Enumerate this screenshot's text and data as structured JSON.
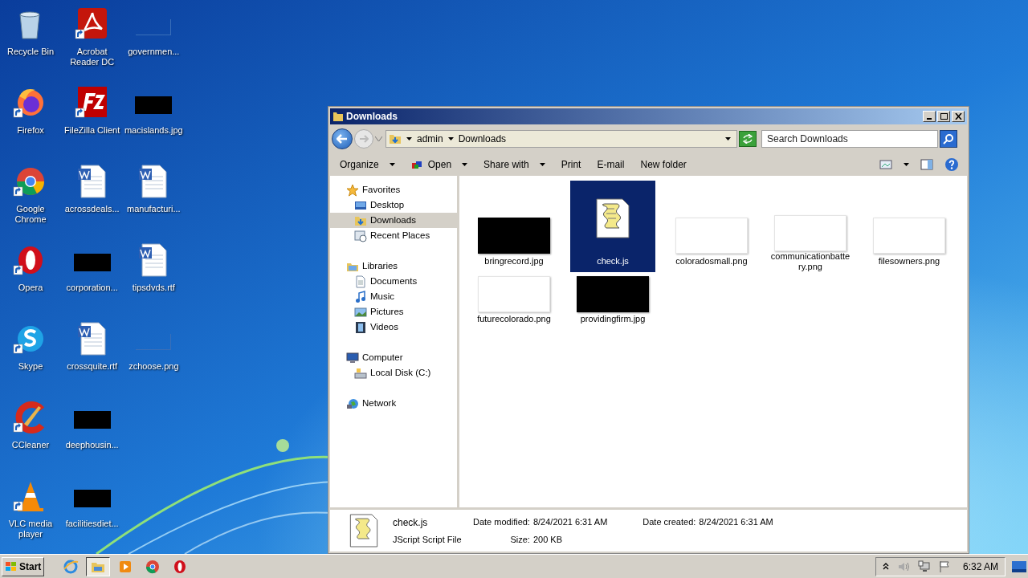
{
  "desktop": {
    "icons": [
      {
        "label": "Recycle Bin",
        "kind": "app"
      },
      {
        "label": "Firefox",
        "kind": "app"
      },
      {
        "label": "Google Chrome",
        "kind": "app"
      },
      {
        "label": "Opera",
        "kind": "app"
      },
      {
        "label": "Skype",
        "kind": "app"
      },
      {
        "label": "CCleaner",
        "kind": "app"
      },
      {
        "label": "VLC media player",
        "kind": "app"
      },
      {
        "label": "Acrobat Reader DC",
        "kind": "app"
      },
      {
        "label": "FileZilla Client",
        "kind": "app"
      },
      {
        "label": "acrossdeals...",
        "kind": "document"
      },
      {
        "label": "corporation...",
        "kind": "dark"
      },
      {
        "label": "crossquite.rtf",
        "kind": "document"
      },
      {
        "label": "deephousin...",
        "kind": "dark"
      },
      {
        "label": "facilitiesdiet...",
        "kind": "dark"
      },
      {
        "label": "governmen...",
        "kind": "frame"
      },
      {
        "label": "macislands.jpg",
        "kind": "dark"
      },
      {
        "label": "manufacturi...",
        "kind": "document"
      },
      {
        "label": "tipsdvds.rtf",
        "kind": "document"
      },
      {
        "label": "zchoose.png",
        "kind": "frame"
      }
    ]
  },
  "window": {
    "title": "Downloads",
    "address": {
      "crumbs": [
        "admin",
        "Downloads"
      ]
    },
    "search": {
      "placeholder": "Search Downloads"
    },
    "toolbar": [
      {
        "label": "Organize",
        "dropdown": true
      },
      {
        "label": "Open",
        "dropdown": true
      },
      {
        "label": "Share with",
        "dropdown": true
      },
      {
        "label": "Print",
        "dropdown": false
      },
      {
        "label": "E-mail",
        "dropdown": false
      },
      {
        "label": "New folder",
        "dropdown": false
      }
    ],
    "navigation": [
      {
        "label": "Favorites",
        "selected": false,
        "children": [
          {
            "label": "Desktop",
            "selected": false
          },
          {
            "label": "Downloads",
            "selected": true
          },
          {
            "label": "Recent Places",
            "selected": false
          }
        ]
      },
      {
        "label": "Libraries",
        "selected": false,
        "children": [
          {
            "label": "Documents",
            "selected": false
          },
          {
            "label": "Music",
            "selected": false
          },
          {
            "label": "Pictures",
            "selected": false
          },
          {
            "label": "Videos",
            "selected": false
          }
        ]
      },
      {
        "label": "Computer",
        "selected": false,
        "children": [
          {
            "label": "Local Disk (C:)",
            "selected": false
          }
        ]
      },
      {
        "label": "Network",
        "selected": false
      }
    ],
    "files": [
      {
        "name": "bringrecord.jpg",
        "kind": "dark",
        "selected": false
      },
      {
        "name": "check.js",
        "kind": "script",
        "selected": true
      },
      {
        "name": "coloradosmall.png",
        "kind": "light",
        "selected": false
      },
      {
        "name": "communicationbattery.png",
        "kind": "light",
        "selected": false
      },
      {
        "name": "filesowners.png",
        "kind": "light",
        "selected": false
      },
      {
        "name": "futurecolorado.png",
        "kind": "light",
        "selected": false
      },
      {
        "name": "providingfirm.jpg",
        "kind": "dark",
        "selected": false
      }
    ],
    "details": {
      "name": "check.js",
      "type": "JScript Script File",
      "fields": [
        {
          "label": "Date modified:",
          "value": "8/24/2021 6:31 AM"
        },
        {
          "label": "Date created:",
          "value": "8/24/2021 6:31 AM"
        },
        {
          "label": "Size:",
          "value": "200 KB"
        }
      ]
    }
  },
  "taskbar": {
    "start": "Start",
    "apps": [
      {
        "selected": false
      },
      {
        "selected": true
      },
      {
        "selected": false
      },
      {
        "selected": false
      },
      {
        "selected": false
      }
    ],
    "clock": "6:32 AM"
  }
}
